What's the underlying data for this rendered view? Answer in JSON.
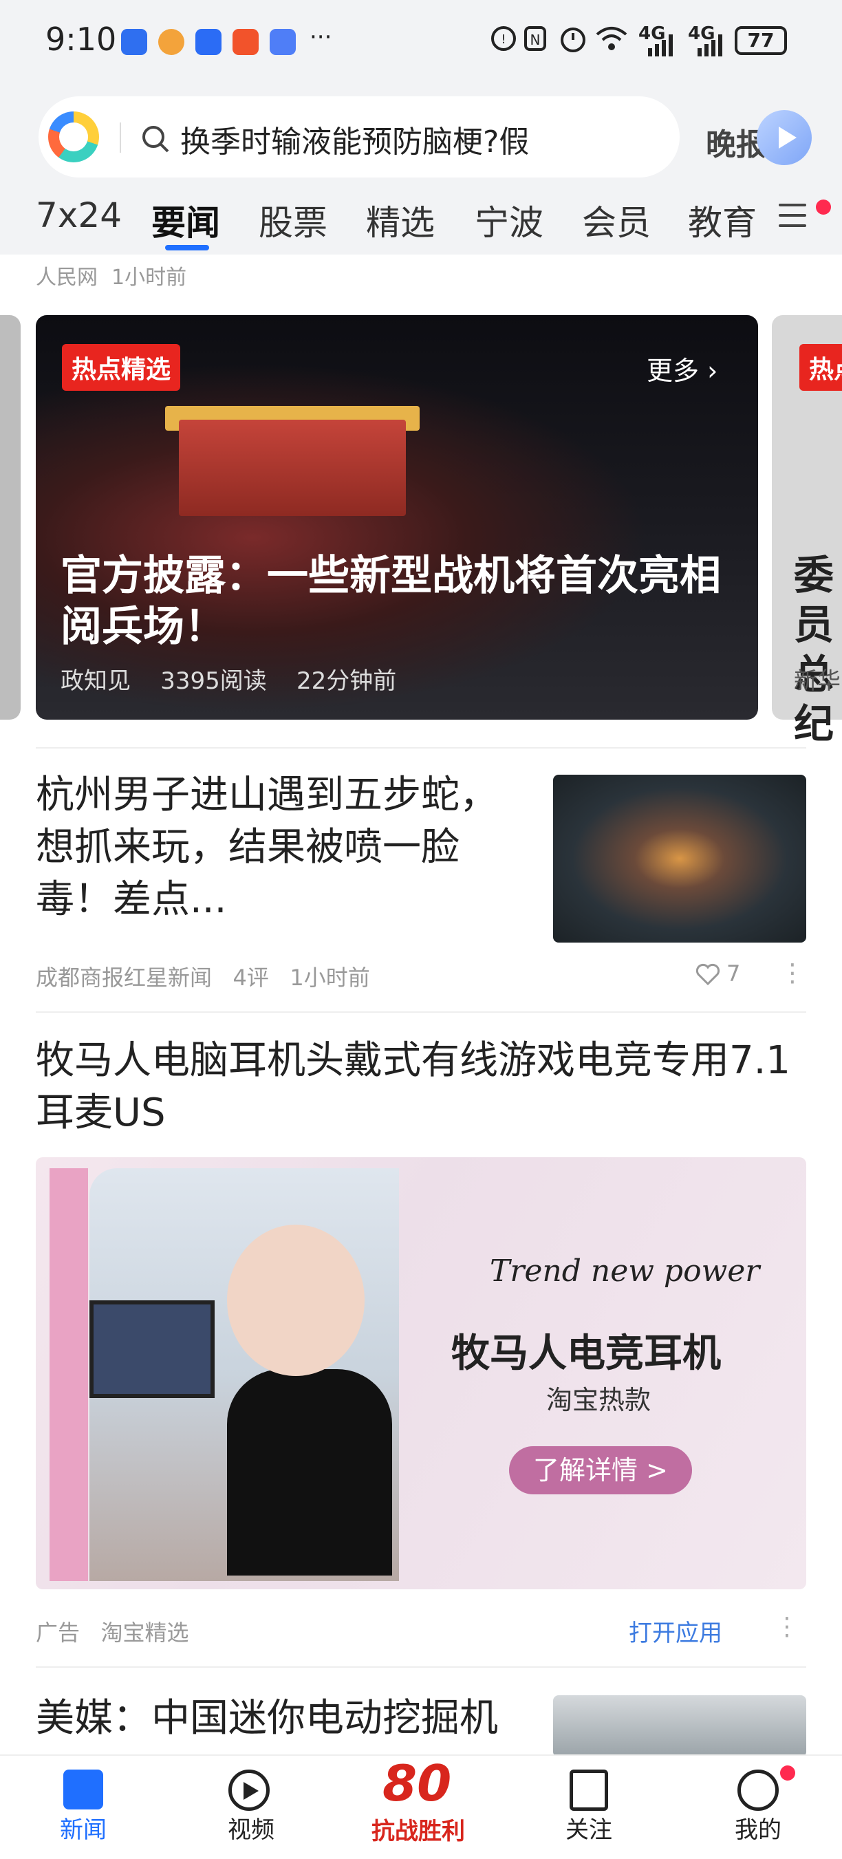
{
  "status_bar": {
    "time": "9:10",
    "right_text": "6 4G 4G",
    "battery": "77",
    "app_icon_colors": [
      "#2f6ff0",
      "#f3a33b",
      "#2b6cf5",
      "#f2532b",
      "#4f7ef7"
    ]
  },
  "header": {
    "search_text": "换季时输液能预防脑梗?假",
    "evening_label": "晚报",
    "tabs": [
      "7x24",
      "要闻",
      "股票",
      "精选",
      "宁波",
      "会员",
      "教育"
    ],
    "active_tab": "要闻"
  },
  "top_meta": {
    "source": "人民网",
    "time": "1小时前"
  },
  "carousel": {
    "tag": "热点精选",
    "more_label": "更多",
    "title": "官方披露：一些新型战机将首次亮相阅兵场！",
    "source": "政知见",
    "reads": "3395阅读",
    "time": "22分钟前",
    "side_title": "委员总纪",
    "side_source": "新华"
  },
  "news": [
    {
      "title": "杭州男子进山遇到五步蛇，想抓来玩，结果被喷一脸毒！差点...",
      "source": "成都商报红星新闻",
      "comments": "4评",
      "time": "1小时前",
      "likes": "7"
    }
  ],
  "ad": {
    "title": "牧马人电脑耳机头戴式有线游戏电竞专用7.1耳麦US",
    "trend": "Trend new power",
    "headline": "牧马人电竞耳机",
    "sub": "淘宝热款",
    "cta": "了解详情 >",
    "label": "广告",
    "source": "淘宝精选",
    "open_app": "打开应用"
  },
  "next_news": {
    "title": "美媒：中国迷你电动挖掘机"
  },
  "bottom_nav": {
    "items": [
      "新闻",
      "视频",
      "抗战胜利",
      "关注",
      "我的"
    ],
    "victory_badge": "80"
  },
  "icons": [
    "search-icon",
    "play-icon",
    "menu-icon",
    "chevron-right-icon",
    "heart-icon",
    "more-icon",
    "news-icon",
    "video-icon",
    "follow-icon",
    "me-icon"
  ]
}
